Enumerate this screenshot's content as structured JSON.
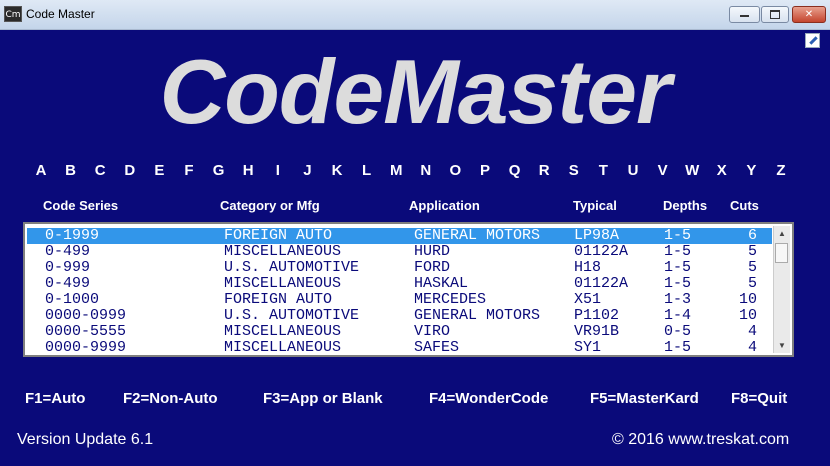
{
  "window": {
    "title": "Code Master",
    "icon_text": "Cm"
  },
  "logo": "CodeMaster",
  "letters": [
    "A",
    "B",
    "C",
    "D",
    "E",
    "F",
    "G",
    "H",
    "I",
    "J",
    "K",
    "L",
    "M",
    "N",
    "O",
    "P",
    "Q",
    "R",
    "S",
    "T",
    "U",
    "V",
    "W",
    "X",
    "Y",
    "Z"
  ],
  "columns": {
    "code_series": "Code Series",
    "category": "Category or Mfg",
    "application": "Application",
    "typical": "Typical",
    "depths": "Depths",
    "cuts": "Cuts"
  },
  "rows": [
    {
      "code": "0-1999",
      "category": "FOREIGN AUTO",
      "application": "GENERAL MOTORS",
      "typical": "LP98A",
      "depths": "1-5",
      "cuts": "6",
      "selected": true
    },
    {
      "code": "0-499",
      "category": "MISCELLANEOUS",
      "application": "HURD",
      "typical": "01122A",
      "depths": "1-5",
      "cuts": "5"
    },
    {
      "code": "0-999",
      "category": "U.S. AUTOMOTIVE",
      "application": "FORD",
      "typical": "H18",
      "depths": "1-5",
      "cuts": "5"
    },
    {
      "code": "0-499",
      "category": "MISCELLANEOUS",
      "application": "HASKAL",
      "typical": "01122A",
      "depths": "1-5",
      "cuts": "5"
    },
    {
      "code": "0-1000",
      "category": "FOREIGN AUTO",
      "application": "MERCEDES",
      "typical": "X51",
      "depths": "1-3",
      "cuts": "10"
    },
    {
      "code": "0000-0999",
      "category": "U.S. AUTOMOTIVE",
      "application": "GENERAL MOTORS",
      "typical": "P1102",
      "depths": "1-4",
      "cuts": "10"
    },
    {
      "code": "0000-5555",
      "category": "MISCELLANEOUS",
      "application": "VIRO",
      "typical": "VR91B",
      "depths": "0-5",
      "cuts": "4"
    },
    {
      "code": "0000-9999",
      "category": "MISCELLANEOUS",
      "application": "SAFES",
      "typical": "SY1",
      "depths": "1-5",
      "cuts": "4"
    }
  ],
  "function_keys": {
    "f1": "F1=Auto",
    "f2": "F2=Non-Auto",
    "f3": "F3=App or Blank",
    "f4": "F4=WonderCode",
    "f5": "F5=MasterKard",
    "f8": "F8=Quit"
  },
  "footer": {
    "version": "Version Update 6.1",
    "copyright": "© 2016 www.treskat.com"
  },
  "icons": {
    "app": "app-icon",
    "minimize": "minimize-icon",
    "maximize": "maximize-icon",
    "close": "close-icon",
    "edit": "edit-icon"
  },
  "colors": {
    "background": "#0a0a7a",
    "selection": "#3296ea",
    "logo": "#dcdcdc"
  }
}
